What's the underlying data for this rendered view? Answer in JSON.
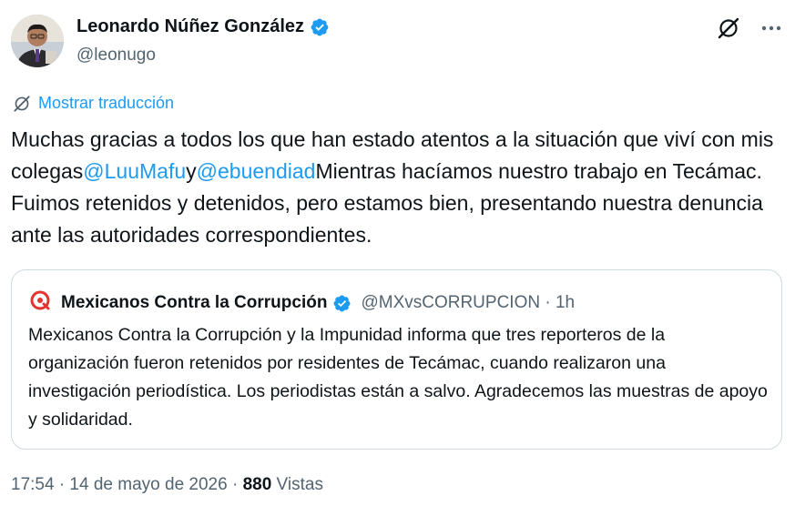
{
  "author": {
    "name": "Leonardo Núñez González",
    "handle": "@leonugo",
    "avatar_icon": "profile-photo"
  },
  "actions": {
    "grok_icon": "grok-icon",
    "more_icon": "more-options-icon"
  },
  "translate": {
    "label": "Mostrar traducción",
    "icon": "grok-icon"
  },
  "tweet": {
    "part1": "Muchas gracias a todos los que han estado atentos a la situación que viví con mis colegas",
    "mention1": "@LuuMafu",
    "part2": "y",
    "mention2": "@ebuendiad",
    "part3": "Mientras hacíamos nuestro trabajo en Tecámac. Fuimos retenidos y detenidos, pero estamos bien, presentando nuestra denuncia ante las autoridades correspondientes."
  },
  "quote": {
    "name": "Mexicanos Contra la Corrupción",
    "handle": "@MXvsCORRUPCION · 1h",
    "text": "Mexicanos Contra la Corrupción y la Impunidad informa que tres reporteros de la organización fueron retenidos por residentes de Tecámac, cuando realizaron una investigación periodística. Los periodistas están a salvo. Agradecemos las muestras de apoyo y solidaridad.",
    "logo_icon": "mcci-logo"
  },
  "footer": {
    "timestamp": "17:54 · 14 de mayo de 2026 · ",
    "views_count": "880",
    "views_label": " Vistas"
  },
  "colors": {
    "text": "#0f1419",
    "secondary": "#536471",
    "link": "#1d9bf0",
    "border": "#cfd9de",
    "mcci_red": "#e3342f"
  }
}
